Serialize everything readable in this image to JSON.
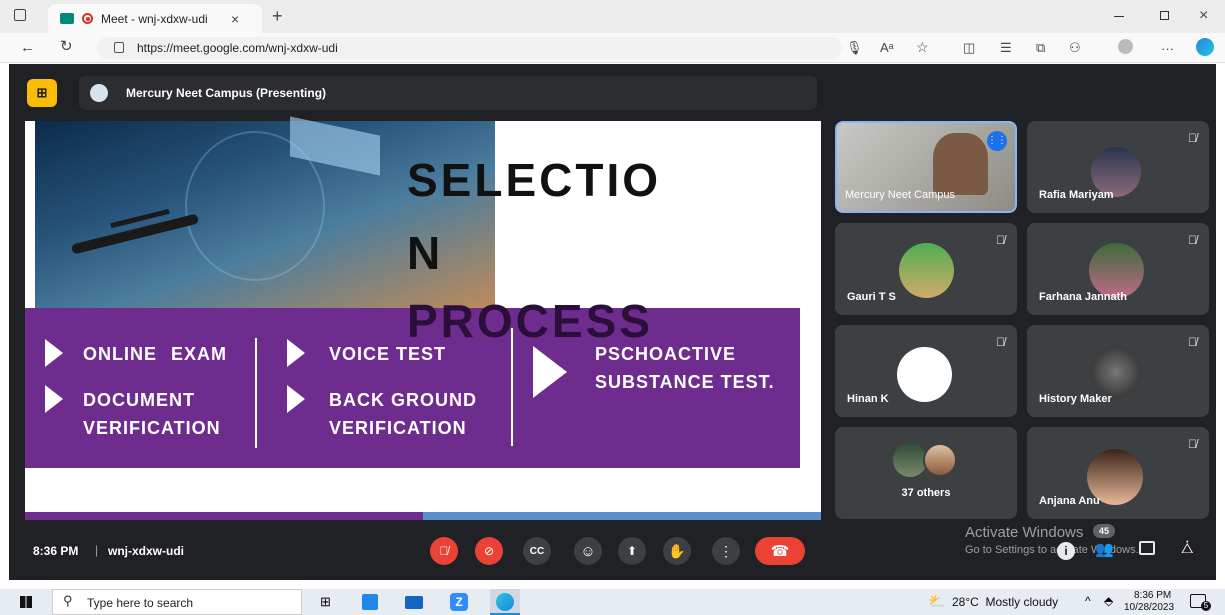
{
  "browser": {
    "tab_title": "Meet - wnj-xdxw-udi",
    "new_tab_glyph": "+",
    "close_glyph": "×",
    "url": "https://meet.google.com/wnj-xdxw-udi",
    "zoom_glyph": "Aᵃ",
    "more_glyph": "···"
  },
  "meet": {
    "presenter_label": "Mercury Neet Campus (Presenting)",
    "time": "8:36 PM",
    "separator": "|",
    "meeting_code": "wnj-xdxw-udi"
  },
  "slide": {
    "title_line1": "SELECTIO",
    "title_line2": "N",
    "title_line3": "PROCESS",
    "items": [
      "ONLINE EXAM",
      "VOICE TEST",
      "PSCHOACTIVE SUBSTANCE TEST.",
      "DOCUMENT VERIFICATION",
      "BACK GROUND VERIFICATION"
    ]
  },
  "participants": [
    {
      "name": "Mercury Neet Campus",
      "speaking": true
    },
    {
      "name": "Rafia Mariyam",
      "muted": true
    },
    {
      "name": "Gauri T S",
      "muted": true
    },
    {
      "name": "Farhana Jannath",
      "muted": true
    },
    {
      "name": "Hinan K",
      "muted": true
    },
    {
      "name": "History Maker",
      "muted": true
    },
    {
      "name": "37 others"
    },
    {
      "name": "Anjana Anu",
      "muted": true
    }
  ],
  "watermark": {
    "title": "Activate Windows",
    "subtitle": "Go to Settings to activate Windows."
  },
  "people_count": "45",
  "taskbar": {
    "search_placeholder": "Type here to search",
    "weather": "28°C  Mostly cloudy",
    "time": "8:36 PM",
    "date": "10/28/2023",
    "notif_count": "5"
  },
  "colors": {
    "meet_bg": "#202124",
    "tile_bg": "#3c4043",
    "end_call": "#ea4335",
    "slide_purple": "#6e2c8e",
    "presenter_badge": "#fbbc04"
  }
}
